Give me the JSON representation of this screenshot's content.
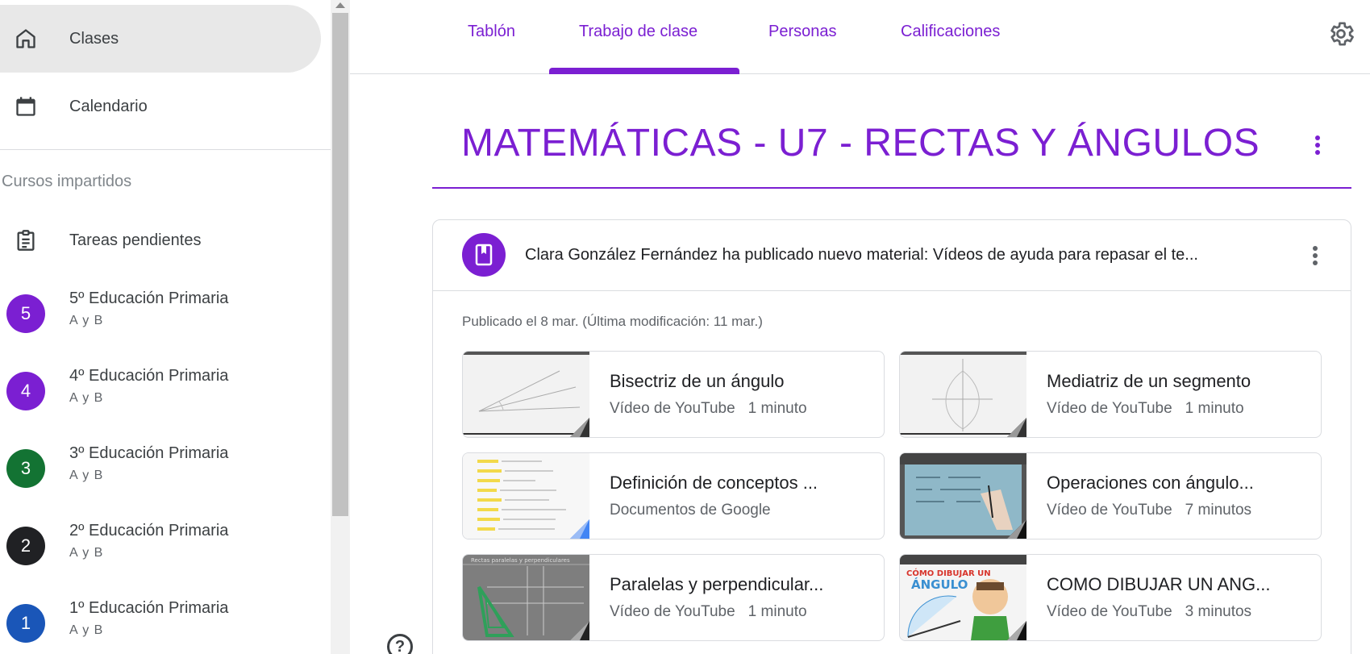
{
  "sidebar": {
    "nav": [
      {
        "label": "Clases",
        "icon": "home-icon"
      },
      {
        "label": "Calendario",
        "icon": "calendar-icon"
      }
    ],
    "section_title": "Cursos impartidos",
    "pending": {
      "label": "Tareas pendientes",
      "icon": "assignment-icon"
    },
    "courses": [
      {
        "avatar": "5",
        "name": "5º Educación Primaria",
        "section": "A y B",
        "color": "#7b1fd2"
      },
      {
        "avatar": "4",
        "name": "4º Educación Primaria",
        "section": "A y B",
        "color": "#7b1fd2"
      },
      {
        "avatar": "3",
        "name": "3º Educación Primaria",
        "section": "A y B",
        "color": "#137333"
      },
      {
        "avatar": "2",
        "name": "2º Educación Primaria",
        "section": "A y B",
        "color": "#202124"
      },
      {
        "avatar": "1",
        "name": "1º Educación Primaria",
        "section": "A y B",
        "color": "#1a56b8"
      }
    ]
  },
  "tabs": [
    {
      "label": "Tablón"
    },
    {
      "label": "Trabajo de clase",
      "active": true
    },
    {
      "label": "Personas"
    },
    {
      "label": "Calificaciones"
    }
  ],
  "topic": {
    "title": "MATEMÁTICAS - U7 - RECTAS Y ÁNGULOS"
  },
  "material": {
    "title": "Clara González Fernández ha publicado nuevo material: Vídeos de ayuda para repasar el te...",
    "published": "Publicado el 8 mar. (Última modificación: 11 mar.)",
    "attachments": [
      {
        "title": "Bisectriz de un ángulo",
        "type": "Vídeo de YouTube",
        "duration": "1 minuto"
      },
      {
        "title": "Mediatriz de un segmento",
        "type": "Vídeo de YouTube",
        "duration": "1 minuto"
      },
      {
        "title": "Definición de conceptos ...",
        "type": "Documentos de Google",
        "duration": ""
      },
      {
        "title": "Operaciones con ángulo...",
        "type": "Vídeo de YouTube",
        "duration": "7 minutos"
      },
      {
        "title": "Paralelas y perpendicular...",
        "type": "Vídeo de YouTube",
        "duration": "1 minuto"
      },
      {
        "title": "COMO DIBUJAR UN ANG...",
        "type": "Vídeo de YouTube",
        "duration": "3 minutos"
      }
    ]
  },
  "thumbnails": {
    "rectas_title": "Rectas paralelas y perpendiculares",
    "dibujar_line1": "CÓMO DIBUJAR UN",
    "dibujar_line2": "ÁNGULO"
  },
  "colors": {
    "accent": "#7b1fd2",
    "docs_blue": "#4285f4"
  }
}
